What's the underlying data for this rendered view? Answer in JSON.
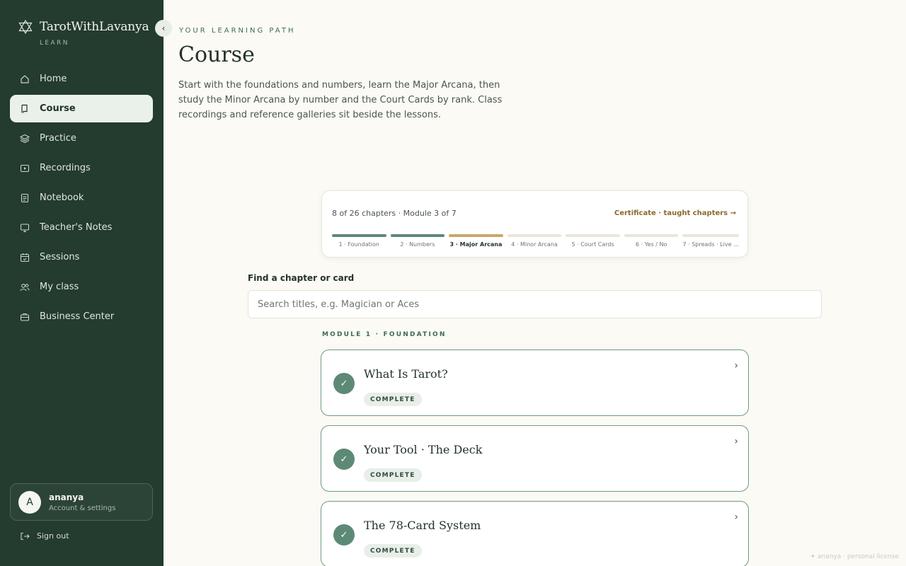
{
  "app": {
    "brand": "TarotWithLavanya",
    "brand_sub": "LEARN"
  },
  "sidebar": {
    "items": [
      {
        "label": "Home",
        "icon": "home-icon"
      },
      {
        "label": "Course",
        "icon": "book-icon",
        "active": true
      },
      {
        "label": "Practice",
        "icon": "layers-icon"
      },
      {
        "label": "Recordings",
        "icon": "play-icon"
      },
      {
        "label": "Notebook",
        "icon": "notebook-icon"
      },
      {
        "label": "Teacher's Notes",
        "icon": "monitor-icon"
      },
      {
        "label": "Sessions",
        "icon": "calendar-icon"
      },
      {
        "label": "My class",
        "icon": "users-icon"
      },
      {
        "label": "Business Center",
        "icon": "briefcase-icon"
      }
    ],
    "user": {
      "initial": "A",
      "name": "ananya",
      "sub": "Account & settings"
    },
    "signout": "Sign out"
  },
  "header": {
    "eyebrow": "YOUR LEARNING PATH",
    "title": "Course",
    "intro": "Start with the foundations and numbers, learn the Major Arcana, then study the Minor Arcana by number and the Court Cards by rank. Class recordings and reference galleries sit beside the lessons."
  },
  "progress": {
    "summary": "8 of 26 chapters · Module 3 of 7",
    "certificate_link": "Certificate · taught chapters →",
    "modules": [
      {
        "label": "1 · Foundation",
        "state": "done"
      },
      {
        "label": "2 · Numbers",
        "state": "done"
      },
      {
        "label": "3 · Major Arcana",
        "state": "current"
      },
      {
        "label": "4 · Minor Arcana",
        "state": "upcoming"
      },
      {
        "label": "5 · Court Cards",
        "state": "upcoming"
      },
      {
        "label": "6 · Yes / No",
        "state": "upcoming"
      },
      {
        "label": "7 · Spreads · Live …",
        "state": "upcoming"
      }
    ]
  },
  "search": {
    "label": "Find a chapter or card",
    "placeholder": "Search titles, e.g. Magician or Aces",
    "value": ""
  },
  "module_section": {
    "heading": "MODULE 1 · FOUNDATION",
    "chapters": [
      {
        "title": "What Is Tarot?",
        "status": "COMPLETE"
      },
      {
        "title": "Your Tool · The Deck",
        "status": "COMPLETE"
      },
      {
        "title": "The 78-Card System",
        "status": "COMPLETE"
      }
    ]
  },
  "footer": {
    "license": "✦ ananya · personal license"
  },
  "colors": {
    "sidebar": "#243b2f",
    "accent": "#5d8a76",
    "gold": "#c9a86a",
    "background": "#fbfaf4"
  }
}
